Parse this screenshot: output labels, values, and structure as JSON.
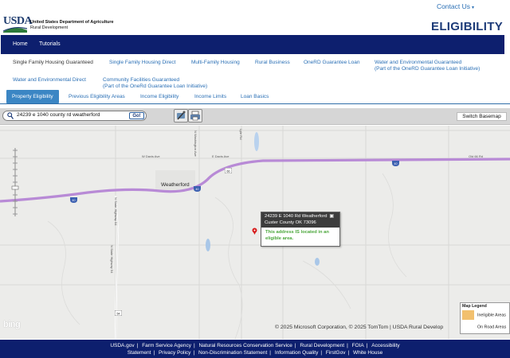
{
  "header": {
    "logo_text": "USDA",
    "department": "United States Department of Agriculture",
    "agency": "Rural Development",
    "contact_label": "Contact Us",
    "page_title": "ELIGIBILITY"
  },
  "main_nav": [
    {
      "label": "Home"
    },
    {
      "label": "Tutorials"
    }
  ],
  "programs": [
    {
      "label": "Single Family Housing Guaranteed",
      "line2": ""
    },
    {
      "label": "Single Family Housing Direct",
      "line2": ""
    },
    {
      "label": "Multi-Family Housing",
      "line2": ""
    },
    {
      "label": "Rural Business",
      "line2": ""
    },
    {
      "label": "OneRD Guarantee Loan",
      "line2": ""
    },
    {
      "label": "Water and Environmental Guaranteed",
      "line2": "(Part of the OneRD Guarantee Loan Initiative)"
    },
    {
      "label": "Water and Environmental Direct",
      "line2": ""
    },
    {
      "label": "Community Facilities Guaranteed",
      "line2": "(Part of the OneRd Guarantee Loan Initiative)"
    }
  ],
  "tabs": [
    {
      "label": "Property Eligibility",
      "active": true
    },
    {
      "label": "Previous Eligibility Areas",
      "active": false
    },
    {
      "label": "Income Eligibility",
      "active": false
    },
    {
      "label": "Income Limits",
      "active": false
    },
    {
      "label": "Loan Basics",
      "active": false
    }
  ],
  "toolbar": {
    "search_value": "24239 e 1040 county rd weatherford",
    "go_label": "Go!",
    "tools": [
      "pan-tool-icon",
      "print-tool-icon"
    ],
    "basemap_label": "Switch Basemap"
  },
  "map": {
    "town_label": "Weatherford",
    "road_labels": [
      "W Davis Ave",
      "E Davis Ave",
      "N Washington Ave",
      "Lyle Rd",
      "Old 66 Rd",
      "N State Highway 54",
      "N State Highway 54"
    ],
    "route_shields": [
      "40",
      "40",
      "66",
      "40",
      "54"
    ],
    "popup": {
      "address": "24239 E 1040 Rd Weatherford",
      "county": "Custer County OK 73096",
      "message": "This address IS located in an eligible area."
    },
    "attribution": "© 2025 Microsoft Corporation, © 2025 TomTom | USDA Rural Develop",
    "provider_logo": "bing"
  },
  "legend": {
    "title": "Map Legend",
    "items": [
      {
        "label": "Ineligible Areas",
        "color": "#f2c06e"
      },
      {
        "label": "On Road Areas",
        "color": "#ffffff"
      }
    ]
  },
  "footer": {
    "row1": [
      "USDA.gov",
      "Farm Service Agency",
      "Natural Resources Conservation Service",
      "Rural Development",
      "FOIA",
      "Accessibility"
    ],
    "row2": [
      "Statement",
      "Privacy Policy",
      "Non-Discrimination Statement",
      "Information Quality",
      "FirstGov",
      "White House"
    ]
  },
  "colors": {
    "nav_bg": "#0d1f6e",
    "link": "#2a6fb5",
    "tab_active": "#3b86c4",
    "highway": "#b88ad6",
    "eligible_text": "#4aa63a"
  }
}
